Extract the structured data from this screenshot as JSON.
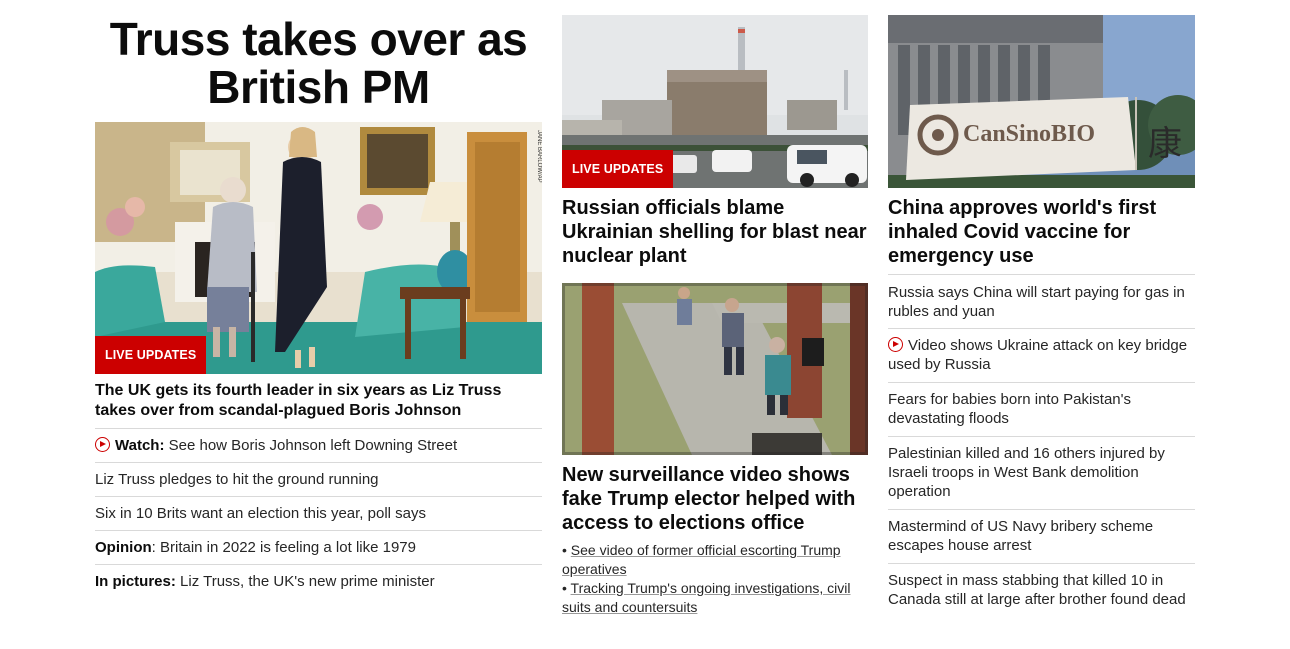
{
  "left": {
    "title_line1": "Truss takes over as",
    "title_line2": "British PM",
    "image_credit": "JANE BARLOW/AP",
    "badge": "LIVE UPDATES",
    "headline": "The UK gets its fourth leader in six years as Liz Truss takes over from scandal-plagued Boris Johnson",
    "links": [
      {
        "prefix": "Watch:",
        "text": " See how Boris Johnson left Downing Street"
      },
      {
        "prefix": "",
        "text": "Liz Truss pledges to hit the ground running"
      },
      {
        "prefix": "",
        "text": "Six in 10 Brits want an election this year, poll says"
      },
      {
        "prefix": "Opinion",
        "text": ": Britain in 2022 is feeling a lot like 1979"
      },
      {
        "prefix": "In pictures:",
        "text": " Liz Truss, the UK's new prime minister"
      }
    ]
  },
  "mid": {
    "story1": {
      "badge": "LIVE UPDATES",
      "headline": "Russian officials blame Ukrainian shelling for blast near nuclear plant"
    },
    "story2": {
      "headline": "New surveillance video shows fake Trump elector helped with access to elections office",
      "bullets": [
        "See video of former official escorting Trump operatives",
        "Tracking Trump's ongoing investigations, civil suits and countersuits"
      ]
    }
  },
  "right": {
    "image_sign": "CanSinoBIO",
    "image_char": "康",
    "headline": "China approves world's first inhaled Covid vaccine for emergency use",
    "links": [
      "Russia says China will start paying for gas in rubles and yuan",
      "Video shows Ukraine attack on key bridge used by Russia",
      "Fears for babies born into Pakistan's devastating floods",
      "Palestinian killed and 16 others injured by Israeli troops in West Bank demolition operation",
      "Mastermind of US Navy bribery scheme escapes house arrest",
      "Suspect in mass stabbing that killed 10 in Canada still at large after brother found dead"
    ]
  },
  "colors": {
    "accent": "#cc0000",
    "divider": "#d9d9d9",
    "text": "#0c0c0c"
  }
}
